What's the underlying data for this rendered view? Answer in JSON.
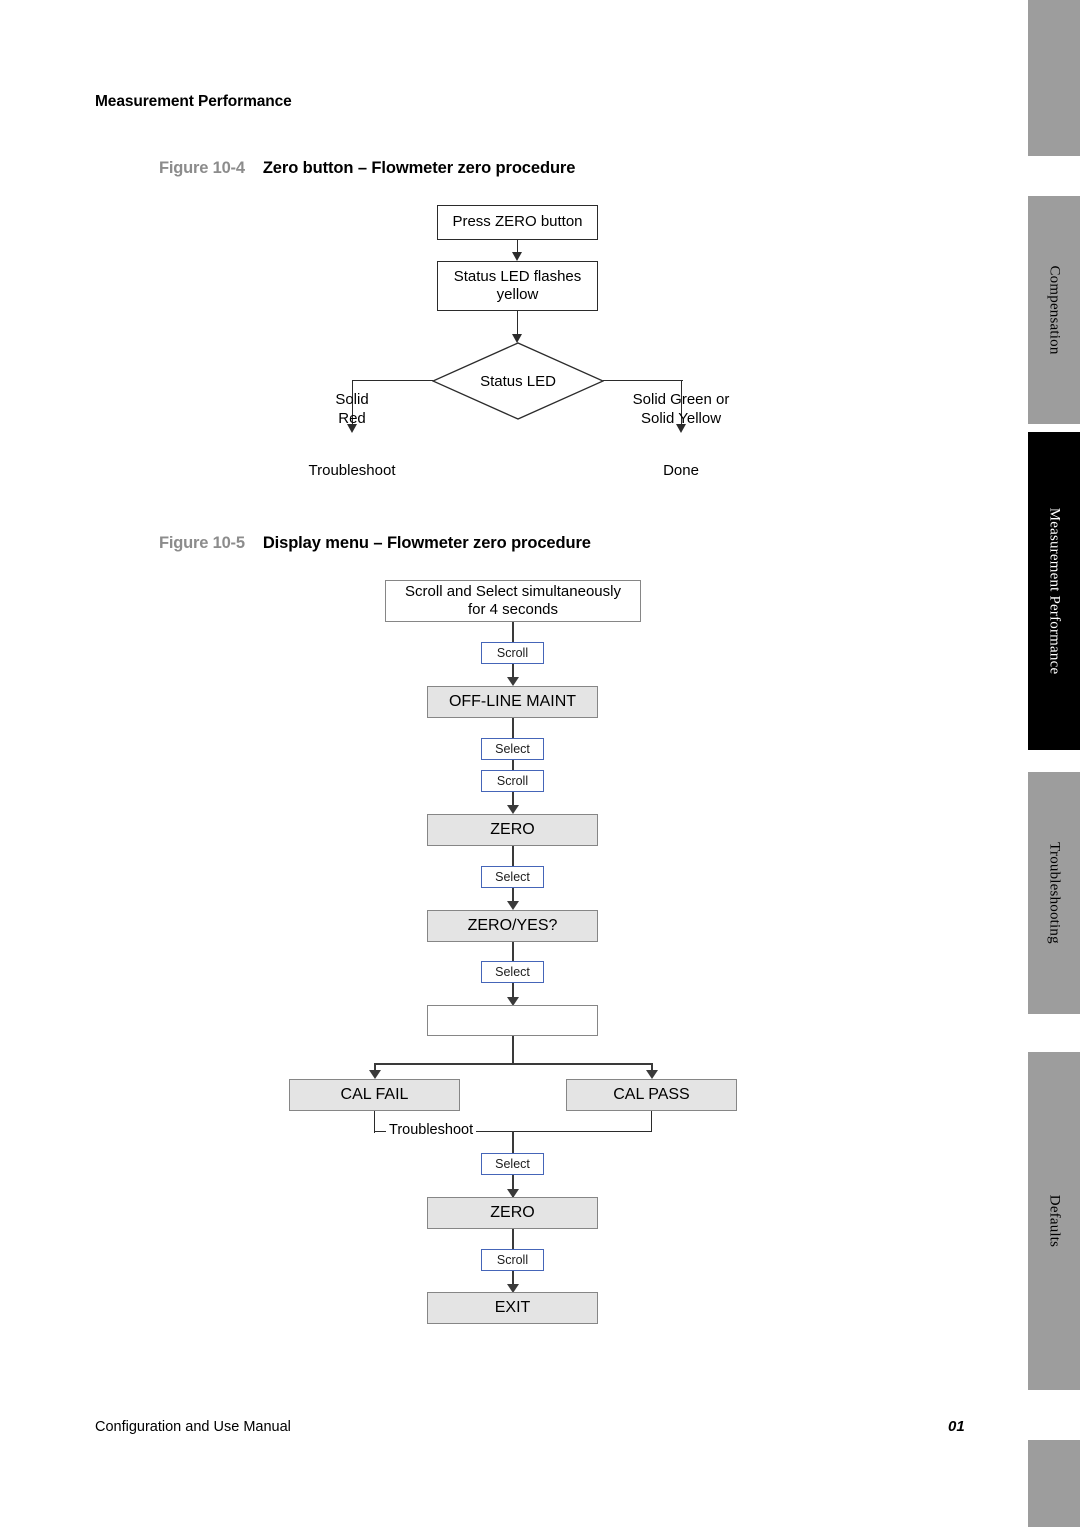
{
  "running_head": "Measurement Performance",
  "footer": {
    "left": "Configuration and Use Manual",
    "page_number": "01"
  },
  "tabs": [
    {
      "label": "",
      "active": false
    },
    {
      "label": "Compensation",
      "active": false
    },
    {
      "label": "Measurement Performance",
      "active": true
    },
    {
      "label": "Troubleshooting",
      "active": false
    },
    {
      "label": "Defaults",
      "active": false
    },
    {
      "label": "",
      "active": false
    }
  ],
  "figure_1": {
    "number": "Figure 10-4",
    "title": "Zero button – Flowmeter zero procedure",
    "nodes": {
      "press_zero": "Press ZERO button",
      "status_flashes": "Status LED flashes\nyellow",
      "decision": "Status LED",
      "branch_left_label": "Solid\nRed",
      "branch_right_label": "Solid Green or\nSolid Yellow",
      "outcome_left": "Troubleshoot",
      "outcome_right": "Done"
    }
  },
  "figure_2": {
    "number": "Figure 10-5",
    "title": "Display menu – Flowmeter zero procedure",
    "nodes": {
      "start": "Scroll  and Select  simultaneously\nfor 4 seconds",
      "off_line_maint": "OFF-LINE MAINT",
      "zero_1": "ZERO",
      "zero_yes": "ZERO/YES?",
      "blank": "",
      "cal_fail": "CAL FAIL",
      "cal_pass": "CAL PASS",
      "troubleshoot": "Troubleshoot",
      "zero_2": "ZERO",
      "exit": "EXIT"
    },
    "keys": {
      "scroll_1": "Scroll",
      "select_1": "Select",
      "scroll_2": "Scroll",
      "select_2": "Select",
      "select_3": "Select",
      "select_4": "Select",
      "scroll_3": "Scroll"
    }
  }
}
